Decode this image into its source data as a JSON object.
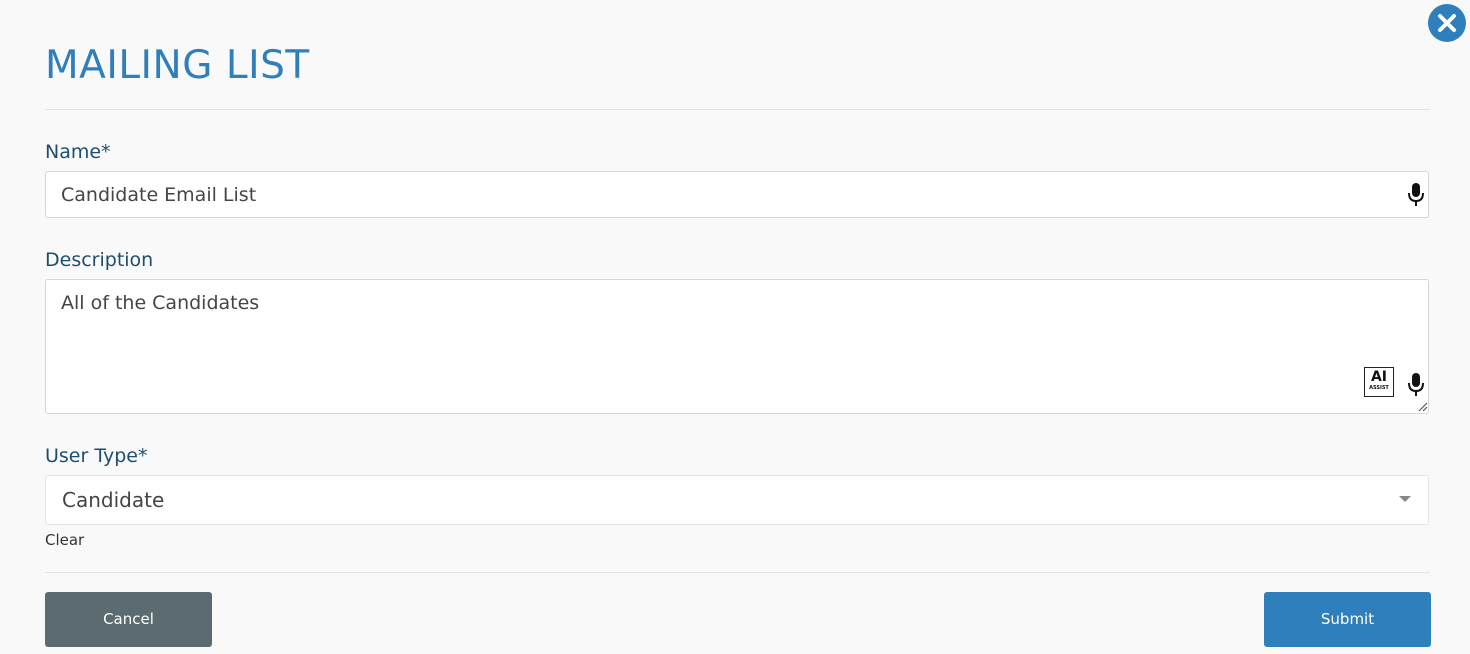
{
  "dialog": {
    "title": "MAILING LIST",
    "close_icon": "close-icon"
  },
  "form": {
    "name": {
      "label": "Name*",
      "value": "Candidate Email List",
      "icon": "microphone-icon"
    },
    "description": {
      "label": "Description",
      "value": "All of the Candidates",
      "ai_assist_label": "AI",
      "ai_assist_sublabel": "ASSIST",
      "icon": "microphone-icon"
    },
    "user_type": {
      "label": "User Type*",
      "selected": "Candidate",
      "clear_label": "Clear"
    }
  },
  "actions": {
    "cancel_label": "Cancel",
    "submit_label": "Submit"
  },
  "colors": {
    "accent": "#2f7fbd",
    "label": "#1d4e6f",
    "cancel_bg": "#5c6b70",
    "background": "#f9f9f9"
  }
}
